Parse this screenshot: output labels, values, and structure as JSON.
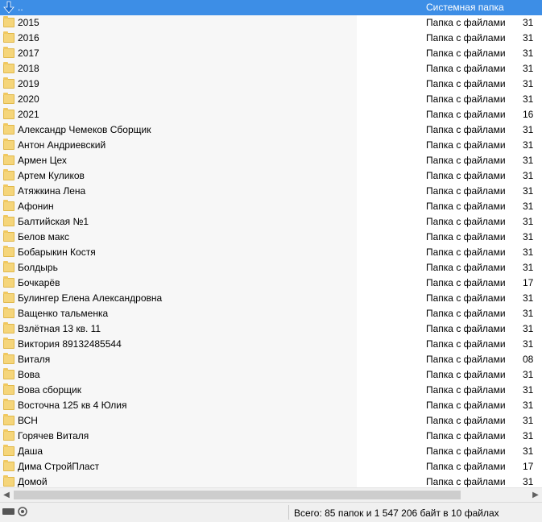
{
  "rows": [
    {
      "name": "..",
      "type": "Системная папка",
      "date": "",
      "selected": true,
      "icon": "up-arrow-icon"
    },
    {
      "name": "2015",
      "type": "Папка с файлами",
      "date": "31"
    },
    {
      "name": "2016",
      "type": "Папка с файлами",
      "date": "31"
    },
    {
      "name": "2017",
      "type": "Папка с файлами",
      "date": "31"
    },
    {
      "name": "2018",
      "type": "Папка с файлами",
      "date": "31"
    },
    {
      "name": "2019",
      "type": "Папка с файлами",
      "date": "31"
    },
    {
      "name": "2020",
      "type": "Папка с файлами",
      "date": "31"
    },
    {
      "name": "2021",
      "type": "Папка с файлами",
      "date": "16"
    },
    {
      "name": "Александр Чемеков Сборщик",
      "type": "Папка с файлами",
      "date": "31"
    },
    {
      "name": "Антон Андриевский",
      "type": "Папка с файлами",
      "date": "31"
    },
    {
      "name": "Армен Цех",
      "type": "Папка с файлами",
      "date": "31"
    },
    {
      "name": "Артем Куликов",
      "type": "Папка с файлами",
      "date": "31"
    },
    {
      "name": "Атяжкина Лена",
      "type": "Папка с файлами",
      "date": "31"
    },
    {
      "name": "Афонин",
      "type": "Папка с файлами",
      "date": "31"
    },
    {
      "name": "Балтийская №1",
      "type": "Папка с файлами",
      "date": "31"
    },
    {
      "name": "Белов макс",
      "type": "Папка с файлами",
      "date": "31"
    },
    {
      "name": "Бобарыкин Костя",
      "type": "Папка с файлами",
      "date": "31"
    },
    {
      "name": "Болдырь",
      "type": "Папка с файлами",
      "date": "31"
    },
    {
      "name": "Бочкарёв",
      "type": "Папка с файлами",
      "date": "17"
    },
    {
      "name": "Булингер Елена Александровна",
      "type": "Папка с файлами",
      "date": "31"
    },
    {
      "name": "Ващенко тальменка",
      "type": "Папка с файлами",
      "date": "31"
    },
    {
      "name": "Взлётная 13 кв. 11",
      "type": "Папка с файлами",
      "date": "31"
    },
    {
      "name": "Виктория 89132485544",
      "type": "Папка с файлами",
      "date": "31"
    },
    {
      "name": "Виталя",
      "type": "Папка с файлами",
      "date": "08"
    },
    {
      "name": "Вова",
      "type": "Папка с файлами",
      "date": "31"
    },
    {
      "name": "Вова сборщик",
      "type": "Папка с файлами",
      "date": "31"
    },
    {
      "name": "Восточна 125 кв 4 Юлия",
      "type": "Папка с файлами",
      "date": "31"
    },
    {
      "name": "ВСН",
      "type": "Папка с файлами",
      "date": "31"
    },
    {
      "name": "Горячев Виталя",
      "type": "Папка с файлами",
      "date": "31"
    },
    {
      "name": "Даша",
      "type": "Папка с файлами",
      "date": "31"
    },
    {
      "name": "Дима СтройПласт",
      "type": "Папка с файлами",
      "date": "17"
    },
    {
      "name": "Домой",
      "type": "Папка с файлами",
      "date": "31"
    }
  ],
  "status": {
    "summary": "Всего: 85 папок и 1 547 206 байт в 10 файлах"
  },
  "icons": {
    "folder": "folder-icon",
    "up": "up-arrow-icon",
    "drive": "drive-icon",
    "network": "network-icon"
  },
  "colors": {
    "selection": "#3d8ee6",
    "folder": "#f5d57a",
    "name_column_bg": "#f7f7f7"
  }
}
